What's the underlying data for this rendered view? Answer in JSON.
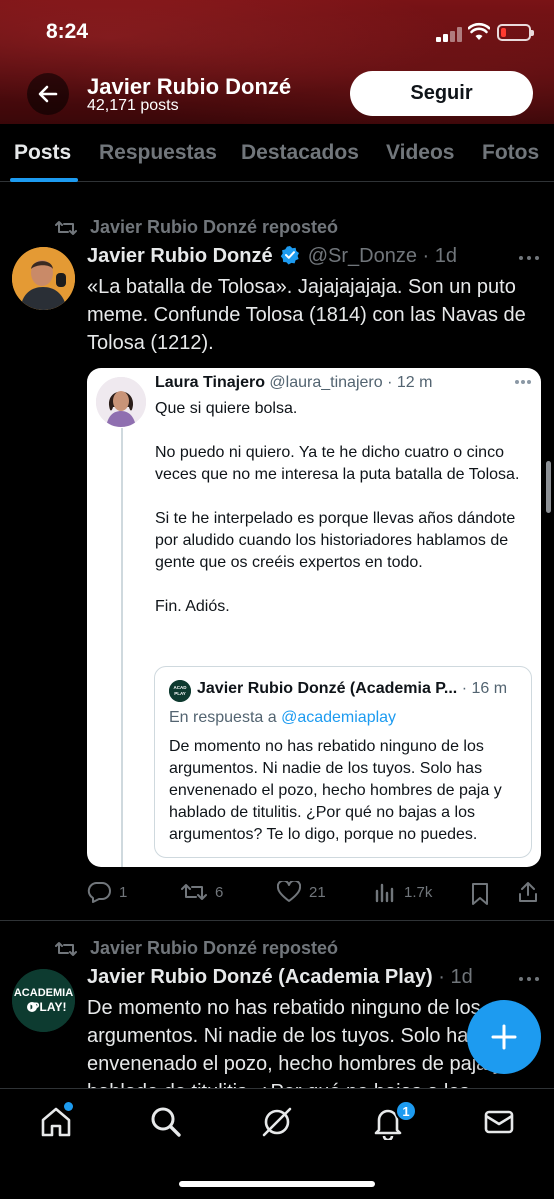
{
  "status": {
    "time": "8:24"
  },
  "header": {
    "name": "Javier Rubio Donzé",
    "posts": "42,171 posts",
    "follow_label": "Seguir"
  },
  "tabs": [
    {
      "label": "Posts",
      "active": true
    },
    {
      "label": "Respuestas"
    },
    {
      "label": "Destacados"
    },
    {
      "label": "Videos"
    },
    {
      "label": "Fotos"
    }
  ],
  "tweet1": {
    "repost_label": "Javier Rubio Donzé reposteó",
    "author": "Javier Rubio Donzé",
    "handle": "@Sr_Donze",
    "dot": "·",
    "time": "1d",
    "text": "«La batalla de Tolosa». Jajajajajaja. Son un puto meme. Confunde Tolosa (1814) con las Navas de Tolosa (1212).",
    "quote": {
      "author": "Laura Tinajero",
      "handle": "@laura_tinajero",
      "time": "· 12 m",
      "paragraphs": [
        "Que si quiere bolsa.",
        "No puedo ni quiero. Ya te he dicho cuatro o cinco veces que no me interesa la puta batalla de Tolosa.",
        "Si te he interpelado es porque llevas años dándote por aludido cuando los historiadores hablamos de gente que os creéis expertos en todo.",
        "Fin. Adiós."
      ],
      "inner": {
        "author": "Javier Rubio Donzé (Academia P...",
        "time": "· 16 m",
        "reply_prefix": "En respuesta a ",
        "reply_to": "@academiaplay",
        "text": "De momento no has rebatido ninguno de los argumentos. Ni nadie de los tuyos. Solo has envenenado el pozo, hecho hombres de paja y hablado de titulitis. ¿Por qué no bajas a los argumentos? Te lo digo, porque no puedes."
      }
    },
    "actions": {
      "replies": "1",
      "reposts": "6",
      "likes": "21",
      "views": "1.7k"
    }
  },
  "tweet2": {
    "repost_label": "Javier Rubio Donzé reposteó",
    "author": "Javier Rubio Donzé (Academia Play)",
    "dot": "·",
    "time": "1d",
    "text": "De momento no has rebatido ninguno de los argumentos. Ni nadie de los tuyos. Solo has envenenado el pozo, hecho hombres de paja y hablado de titulitis. ¿Por qué no bajas a los argumentos?",
    "avatar_text": "ACADEMIA PLAY!"
  },
  "nav": {
    "notifications_count": "1"
  },
  "colors": {
    "accent": "#1d9bf0",
    "header": "#6b1013",
    "background": "#000000"
  }
}
